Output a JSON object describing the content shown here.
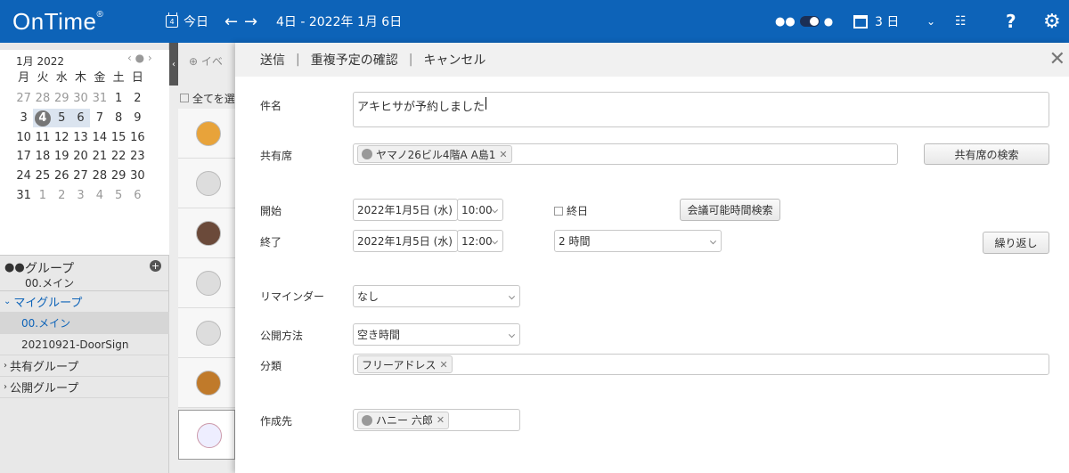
{
  "app": {
    "logo": "OnTime",
    "logo_mark": "®"
  },
  "toolbar": {
    "today_icon_day": "4",
    "today_label": "今日",
    "date_range": "4日 - 2022年 1月 6日",
    "view_days": "3 日",
    "help": "?"
  },
  "mini_calendar": {
    "title": "1月 2022",
    "weekdays": [
      "月",
      "火",
      "水",
      "木",
      "金",
      "土",
      "日"
    ],
    "rows": [
      [
        "27",
        "28",
        "29",
        "30",
        "31",
        "1",
        "2"
      ],
      [
        "3",
        "4",
        "5",
        "6",
        "7",
        "8",
        "9"
      ],
      [
        "10",
        "11",
        "12",
        "13",
        "14",
        "15",
        "16"
      ],
      [
        "17",
        "18",
        "19",
        "20",
        "21",
        "22",
        "23"
      ],
      [
        "24",
        "25",
        "26",
        "27",
        "28",
        "29",
        "30"
      ],
      [
        "31",
        "1",
        "2",
        "3",
        "4",
        "5",
        "6"
      ]
    ]
  },
  "groups": {
    "header": "グループ",
    "header_sub": "00.メイン",
    "my_groups": "マイグループ",
    "my_items": [
      "00.メイン",
      "20210921-DoorSign"
    ],
    "shared": "共有グループ",
    "public": "公開グループ"
  },
  "middle": {
    "add_event": "イベ",
    "select_all": "全てを選"
  },
  "form": {
    "actions": {
      "send": "送信",
      "check": "重複予定の確認",
      "cancel": "キャンセル"
    },
    "subject_label": "件名",
    "subject_value": "アキヒサが予約しました",
    "resource_label": "共有席",
    "resource_chip": "ヤマノ26ビル4階A A島1",
    "resource_search": "共有席の検索",
    "start_label": "開始",
    "start_date": "2022年1月5日 (水)",
    "start_time": "10:00",
    "all_day": "終日",
    "meeting_search": "会議可能時間検索",
    "end_label": "終了",
    "end_date": "2022年1月5日 (水)",
    "end_time": "12:00",
    "duration": "2 時間",
    "repeat": "繰り返し",
    "reminder_label": "リマインダー",
    "reminder_value": "なし",
    "publish_label": "公開方法",
    "publish_value": "空き時間",
    "category_label": "分類",
    "category_chip": "フリーアドレス",
    "creator_label": "作成先",
    "creator_chip": "ハニー 六郎"
  },
  "colors": {
    "brand": "#0d63b8"
  }
}
